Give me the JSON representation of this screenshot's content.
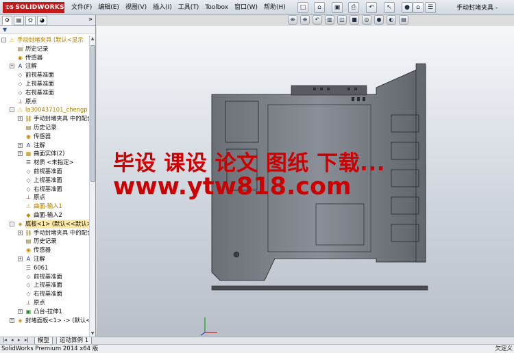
{
  "app": {
    "logo_text": "SOLIDWORKS",
    "document_title": "手动封堵夹具 -"
  },
  "menu": {
    "items": [
      "文件(F)",
      "编辑(E)",
      "视图(V)",
      "插入(I)",
      "工具(T)",
      "Toolbox",
      "窗口(W)",
      "帮助(H)"
    ]
  },
  "panel": {
    "collapse_glyph": "»",
    "filter_glyph": "▼"
  },
  "tree": [
    {
      "label": "手动封堵夹具  (默认<显示",
      "depth": 0,
      "exp": "-",
      "icon": "assembly-warning-icon",
      "style": "warn"
    },
    {
      "label": "历史记录",
      "depth": 1,
      "exp": "",
      "icon": "history-icon"
    },
    {
      "label": "传感器",
      "depth": 1,
      "exp": "",
      "icon": "sensor-icon"
    },
    {
      "label": "注解",
      "depth": 1,
      "exp": "+",
      "icon": "annotation-icon"
    },
    {
      "label": "前视基准面",
      "depth": 1,
      "exp": "",
      "icon": "plane-icon"
    },
    {
      "label": "上视基准面",
      "depth": 1,
      "exp": "",
      "icon": "plane-icon"
    },
    {
      "label": "右视基准面",
      "depth": 1,
      "exp": "",
      "icon": "plane-icon"
    },
    {
      "label": "原点",
      "depth": 1,
      "exp": "",
      "icon": "origin-icon"
    },
    {
      "label": "la300437101_chengp",
      "depth": 1,
      "exp": "-",
      "icon": "part-warning-icon",
      "style": "warn"
    },
    {
      "label": "手动封堵夹具 中的配合",
      "depth": 2,
      "exp": "+",
      "icon": "mates-icon"
    },
    {
      "label": "历史记录",
      "depth": 2,
      "exp": "",
      "icon": "history-icon"
    },
    {
      "label": "传感器",
      "depth": 2,
      "exp": "",
      "icon": "sensor-icon"
    },
    {
      "label": "注解",
      "depth": 2,
      "exp": "+",
      "icon": "annotation-icon"
    },
    {
      "label": "曲面实体(2)",
      "depth": 2,
      "exp": "+",
      "icon": "surface-body-icon"
    },
    {
      "label": "材质 <未指定>",
      "depth": 2,
      "exp": "",
      "icon": "material-icon"
    },
    {
      "label": "前视基准面",
      "depth": 2,
      "exp": "",
      "icon": "plane-icon"
    },
    {
      "label": "上视基准面",
      "depth": 2,
      "exp": "",
      "icon": "plane-icon"
    },
    {
      "label": "右视基准面",
      "depth": 2,
      "exp": "",
      "icon": "plane-icon"
    },
    {
      "label": "原点",
      "depth": 2,
      "exp": "",
      "icon": "origin-icon"
    },
    {
      "label": "曲面-输入1",
      "depth": 2,
      "exp": "",
      "icon": "surface-warning-icon",
      "style": "warn"
    },
    {
      "label": "曲面-输入2",
      "depth": 2,
      "exp": "",
      "icon": "surface-icon"
    },
    {
      "label": "底板<1> (默认<<默认>_",
      "depth": 1,
      "exp": "-",
      "icon": "part-icon",
      "style": "yel"
    },
    {
      "label": "手动封堵夹具 中的配合",
      "depth": 2,
      "exp": "+",
      "icon": "mates-icon"
    },
    {
      "label": "历史记录",
      "depth": 2,
      "exp": "",
      "icon": "history-icon"
    },
    {
      "label": "传感器",
      "depth": 2,
      "exp": "",
      "icon": "sensor-icon"
    },
    {
      "label": "注解",
      "depth": 2,
      "exp": "+",
      "icon": "annotation-icon"
    },
    {
      "label": "6061",
      "depth": 2,
      "exp": "",
      "icon": "material-icon"
    },
    {
      "label": "前视基准面",
      "depth": 2,
      "exp": "",
      "icon": "plane-icon"
    },
    {
      "label": "上视基准面",
      "depth": 2,
      "exp": "",
      "icon": "plane-icon"
    },
    {
      "label": "右视基准面",
      "depth": 2,
      "exp": "",
      "icon": "plane-icon"
    },
    {
      "label": "原点",
      "depth": 2,
      "exp": "",
      "icon": "origin-icon"
    },
    {
      "label": "凸台-拉伸1",
      "depth": 2,
      "exp": "+",
      "icon": "extrude-icon"
    },
    {
      "label": "封堵面板<1> -> (默认<<",
      "depth": 1,
      "exp": "+",
      "icon": "part-icon"
    }
  ],
  "watermark": {
    "line1": "毕设 课设 论文 图纸 下载...",
    "line2": "www.ytw818.com"
  },
  "bottom_tabs": [
    "模型",
    "运动算例 1"
  ],
  "status": {
    "left": "SolidWorks Premium 2014 x64 版",
    "right": "欠定义"
  }
}
